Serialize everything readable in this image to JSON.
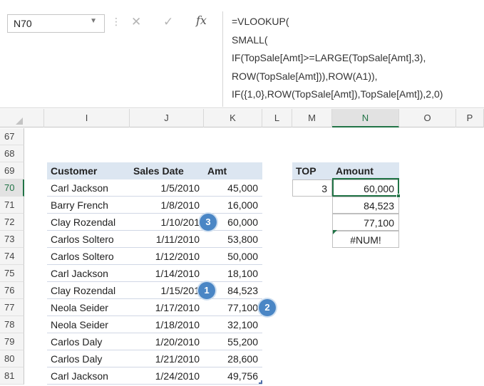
{
  "formula_bar": {
    "name_box": "N70",
    "cancel_glyph": "✕",
    "enter_glyph": "✓",
    "fx_label": "fx",
    "formula_lines": [
      "=VLOOKUP(",
      "SMALL(",
      "IF(TopSale[Amt]>=LARGE(TopSale[Amt],3),",
      "ROW(TopSale[Amt])),ROW(A1)),",
      "IF({1,0},ROW(TopSale[Amt]),TopSale[Amt]),2,0)"
    ]
  },
  "columns": [
    "I",
    "J",
    "K",
    "L",
    "M",
    "N",
    "O",
    "P"
  ],
  "selected_column": "N",
  "rows": [
    "67",
    "68",
    "69",
    "70",
    "71",
    "72",
    "73",
    "74",
    "75",
    "76",
    "77",
    "78",
    "79",
    "80",
    "81"
  ],
  "selected_row": "70",
  "sales_table": {
    "headers": [
      "Customer",
      "Sales Date",
      "Amt"
    ],
    "records": [
      [
        "Carl Jackson",
        "1/5/2010",
        "45,000"
      ],
      [
        "Barry French",
        "1/8/2010",
        "16,000"
      ],
      [
        "Clay Rozendal",
        "1/10/201",
        "60,000"
      ],
      [
        "Carlos Soltero",
        "1/11/2010",
        "53,800"
      ],
      [
        "Carlos Soltero",
        "1/12/2010",
        "50,000"
      ],
      [
        "Carl Jackson",
        "1/14/2010",
        "18,100"
      ],
      [
        "Clay Rozendal",
        "1/15/201",
        "84,523"
      ],
      [
        "Neola Seider",
        "1/17/2010",
        "77,100"
      ],
      [
        "Neola Seider",
        "1/18/2010",
        "32,100"
      ],
      [
        "Carlos Daly",
        "1/20/2010",
        "55,200"
      ],
      [
        "Carlos Daly",
        "1/21/2010",
        "28,600"
      ],
      [
        "Carl Jackson",
        "1/24/2010",
        "49,756"
      ]
    ]
  },
  "top_table": {
    "headers": [
      "TOP",
      "Amount"
    ],
    "top_value": "3",
    "amounts": [
      "60,000",
      "84,523",
      "77,100",
      "#NUM!"
    ]
  },
  "callouts": [
    "3",
    "1",
    "2"
  ],
  "colors": {
    "accent_green": "#217346",
    "table_header_fill": "#dce6f1",
    "callout_blue": "#4a86c5"
  }
}
